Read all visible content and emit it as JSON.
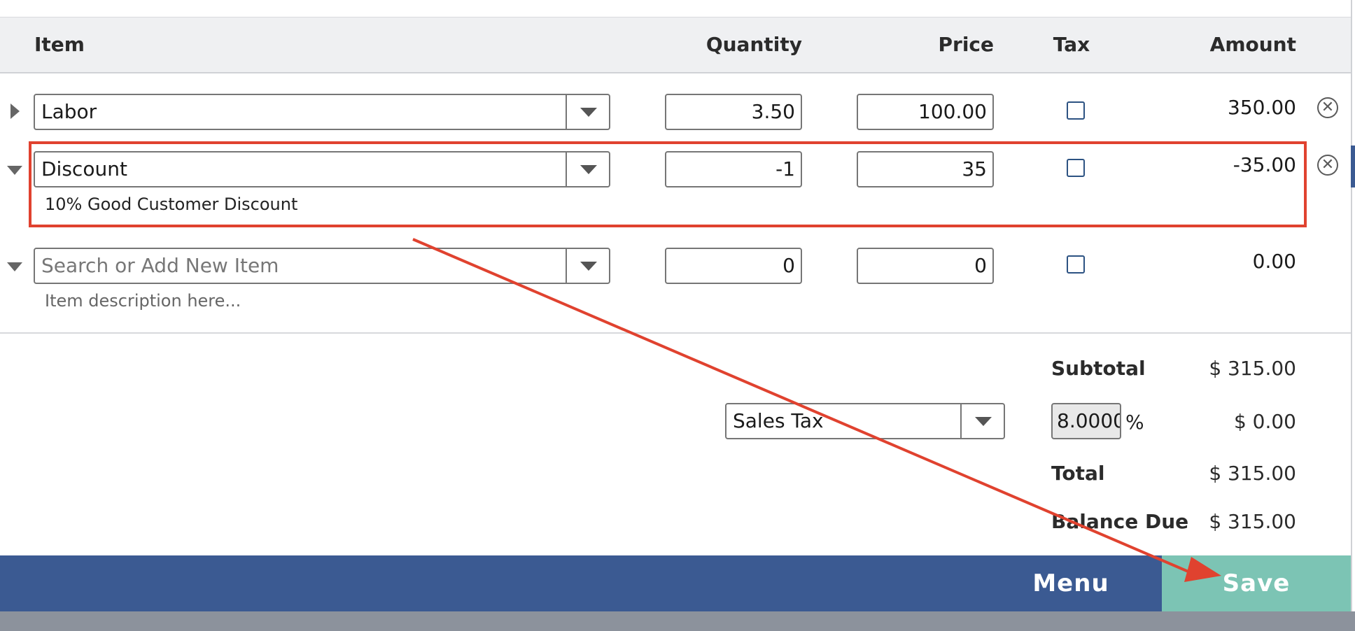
{
  "columns": {
    "item": "Item",
    "quantity": "Quantity",
    "price": "Price",
    "tax": "Tax",
    "amount": "Amount"
  },
  "rows": [
    {
      "item": "Labor",
      "quantity": "3.50",
      "price": "100.00",
      "taxed": false,
      "amount": "350.00",
      "description": ""
    },
    {
      "item": "Discount",
      "quantity": "-1",
      "price": "35",
      "taxed": false,
      "amount": "-35.00",
      "description": "10% Good Customer Discount"
    }
  ],
  "new_row": {
    "item_placeholder": "Search or Add New Item",
    "quantity": "0",
    "price": "0",
    "amount": "0.00",
    "description_placeholder": "Item description here..."
  },
  "totals": {
    "subtotal_label": "Subtotal",
    "subtotal_value": "$ 315.00",
    "tax_select": "Sales Tax",
    "tax_rate": "8.0000",
    "tax_rate_unit": "%",
    "tax_value": "$ 0.00",
    "total_label": "Total",
    "total_value": "$ 315.00",
    "balance_label": "Balance Due",
    "balance_value": "$ 315.00"
  },
  "footer": {
    "menu_label": "Menu",
    "save_label": "Save"
  },
  "colors": {
    "footer_bg": "#3b5a92",
    "save_bg": "#7cc4b4",
    "annotation": "#e0422f",
    "checkbox_border": "#2c5282"
  },
  "icons": {
    "expand_collapsed": "caret-right-icon",
    "expand_open": "caret-down-icon",
    "remove": "circle-x-icon",
    "dropdown": "chevron-down-icon"
  }
}
